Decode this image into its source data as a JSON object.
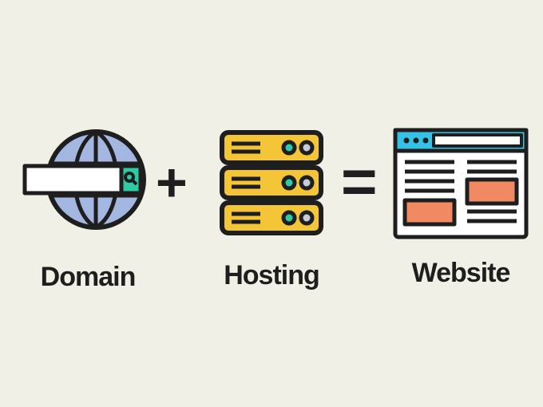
{
  "labels": {
    "domain": "Domain",
    "hosting": "Hosting",
    "website": "Website"
  },
  "operators": {
    "plus": "+",
    "equals": "="
  },
  "colors": {
    "stroke": "#1e1e1e",
    "globe": "#a4b7e0",
    "searchBar": "#ffffff",
    "searchBtn": "#30c9a5",
    "server": "#f4c637",
    "led1": "#30c9a5",
    "led2": "#c5cdd7",
    "browserBar": "#36c2e6",
    "browserBody": "#ffffff",
    "browserBlock": "#f18a62",
    "background": "#f1f0e6"
  }
}
